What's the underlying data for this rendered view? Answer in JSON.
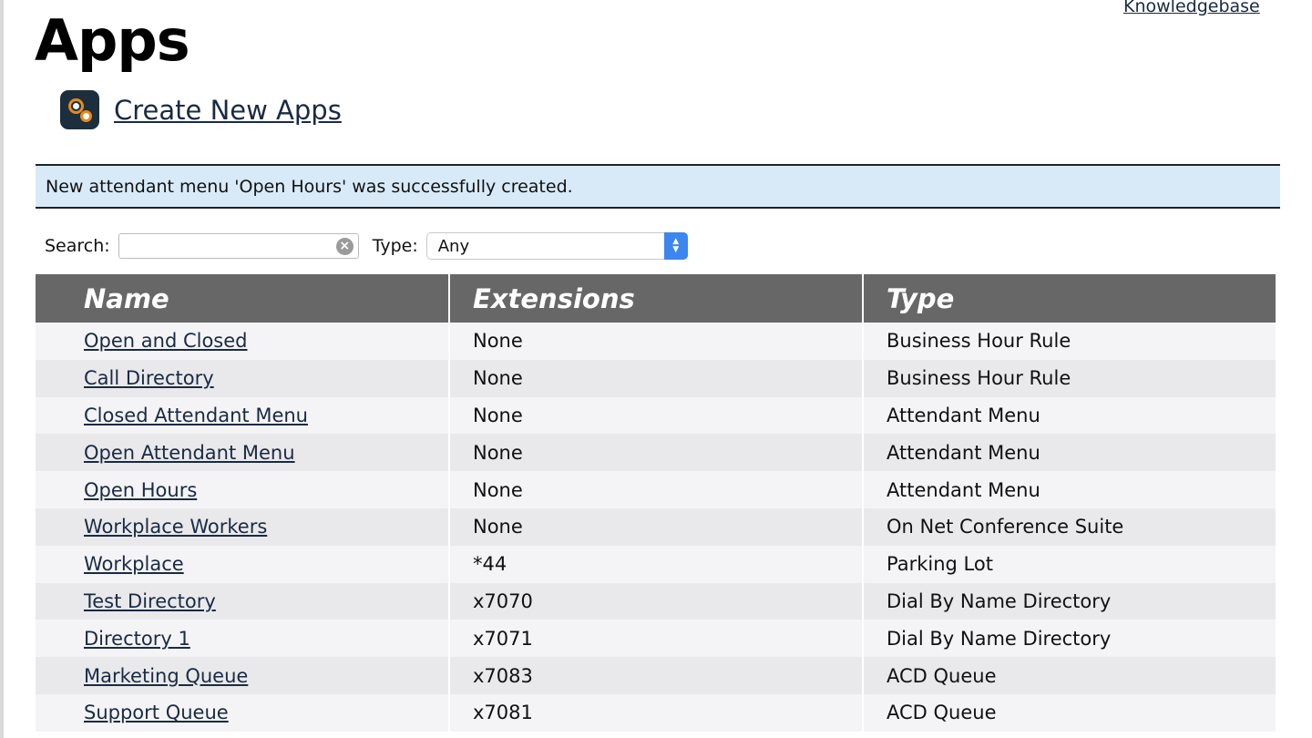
{
  "header": {
    "knowledgebase_link": "Knowledgebase",
    "title": "Apps",
    "create_link": "Create New Apps"
  },
  "notice": {
    "message": "New attendant menu 'Open Hours' was successfully created."
  },
  "filters": {
    "search_label": "Search:",
    "search_value": "",
    "type_label": "Type:",
    "type_selected": "Any"
  },
  "table": {
    "columns": [
      "Name",
      "Extensions",
      "Type"
    ],
    "rows": [
      {
        "name": "Open and Closed",
        "extension": "None",
        "type": "Business Hour Rule"
      },
      {
        "name": "Call Directory",
        "extension": "None",
        "type": "Business Hour Rule"
      },
      {
        "name": "Closed Attendant Menu",
        "extension": "None",
        "type": "Attendant Menu"
      },
      {
        "name": "Open Attendant Menu",
        "extension": "None",
        "type": "Attendant Menu"
      },
      {
        "name": "Open Hours",
        "extension": "None",
        "type": "Attendant Menu"
      },
      {
        "name": "Workplace Workers",
        "extension": "None",
        "type": "On Net Conference Suite"
      },
      {
        "name": "Workplace",
        "extension": "*44",
        "type": "Parking Lot"
      },
      {
        "name": "Test Directory",
        "extension": "x7070",
        "type": "Dial By Name Directory"
      },
      {
        "name": "Directory 1",
        "extension": "x7071",
        "type": "Dial By Name Directory"
      },
      {
        "name": "Marketing Queue",
        "extension": "x7083",
        "type": "ACD Queue"
      },
      {
        "name": "Support Queue",
        "extension": "x7081",
        "type": "ACD Queue"
      }
    ]
  },
  "colors": {
    "header_bg": "#676767",
    "notice_bg": "#d8eaf8",
    "none_text": "#d2141b",
    "link": "#1a2a44",
    "select_accent": "#3b86f0",
    "icon_bg": "#1d2e3d",
    "icon_accent": "#e88a1a"
  },
  "icons": {
    "app": "apps-icon",
    "clear": "clear-search-icon",
    "select": "select-arrows-icon"
  }
}
